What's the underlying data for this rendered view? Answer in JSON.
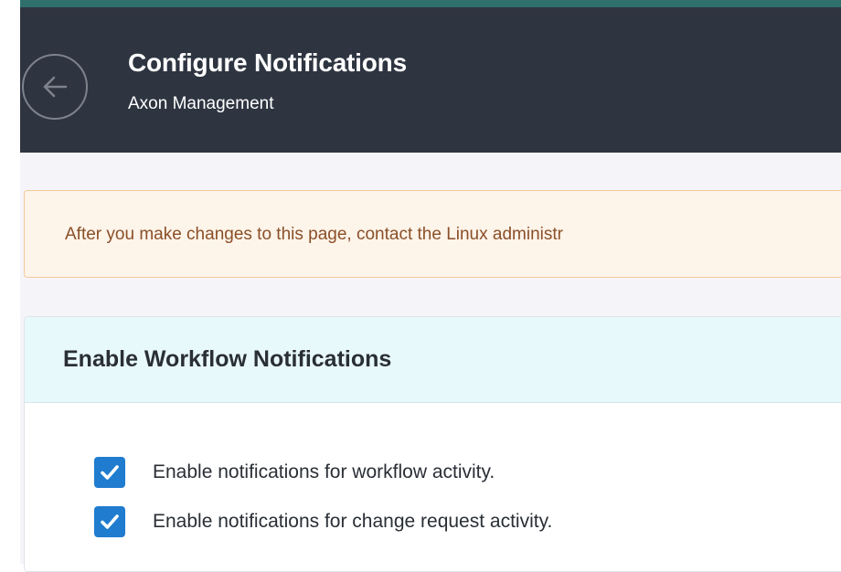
{
  "header": {
    "title": "Configure Notifications",
    "subtitle": "Axon Management",
    "back_icon": "arrow-left-icon"
  },
  "alert": {
    "text": "After you make changes to this page, contact the Linux administr"
  },
  "panel": {
    "title": "Enable Workflow Notifications",
    "options": [
      {
        "label": "Enable notifications for workflow activity.",
        "checked": true
      },
      {
        "label": "Enable notifications for change request activity.",
        "checked": true
      }
    ]
  },
  "colors": {
    "header_bg": "#2e3541",
    "accent_bar": "#2f6f6c",
    "alert_bg": "#fdf4ea",
    "alert_border": "#f5c99a",
    "alert_text": "#8a4f27",
    "panel_header_bg": "#e8f9fc",
    "checkbox": "#1f7ccf"
  }
}
